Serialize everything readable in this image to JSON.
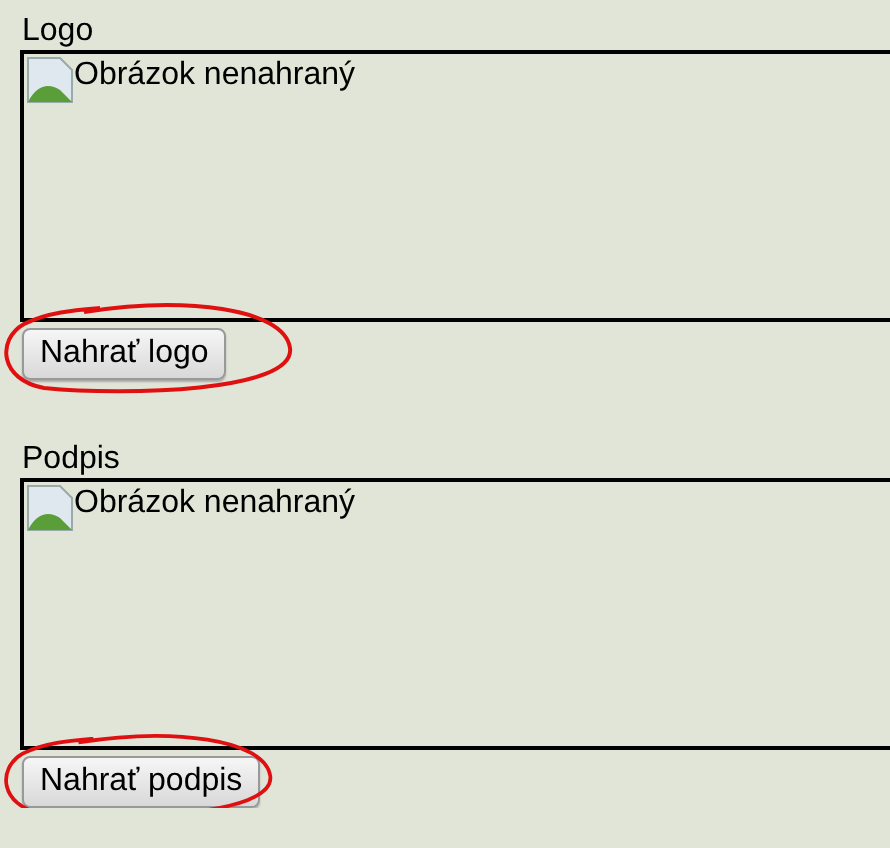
{
  "sections": [
    {
      "label": "Logo",
      "image_alt": "Obrázok nenahraný",
      "button": "Nahrať logo",
      "highlighted": true
    },
    {
      "label": "Podpis",
      "image_alt": "Obrázok nenahraný",
      "button": "Nahrať podpis",
      "highlighted": true
    }
  ]
}
